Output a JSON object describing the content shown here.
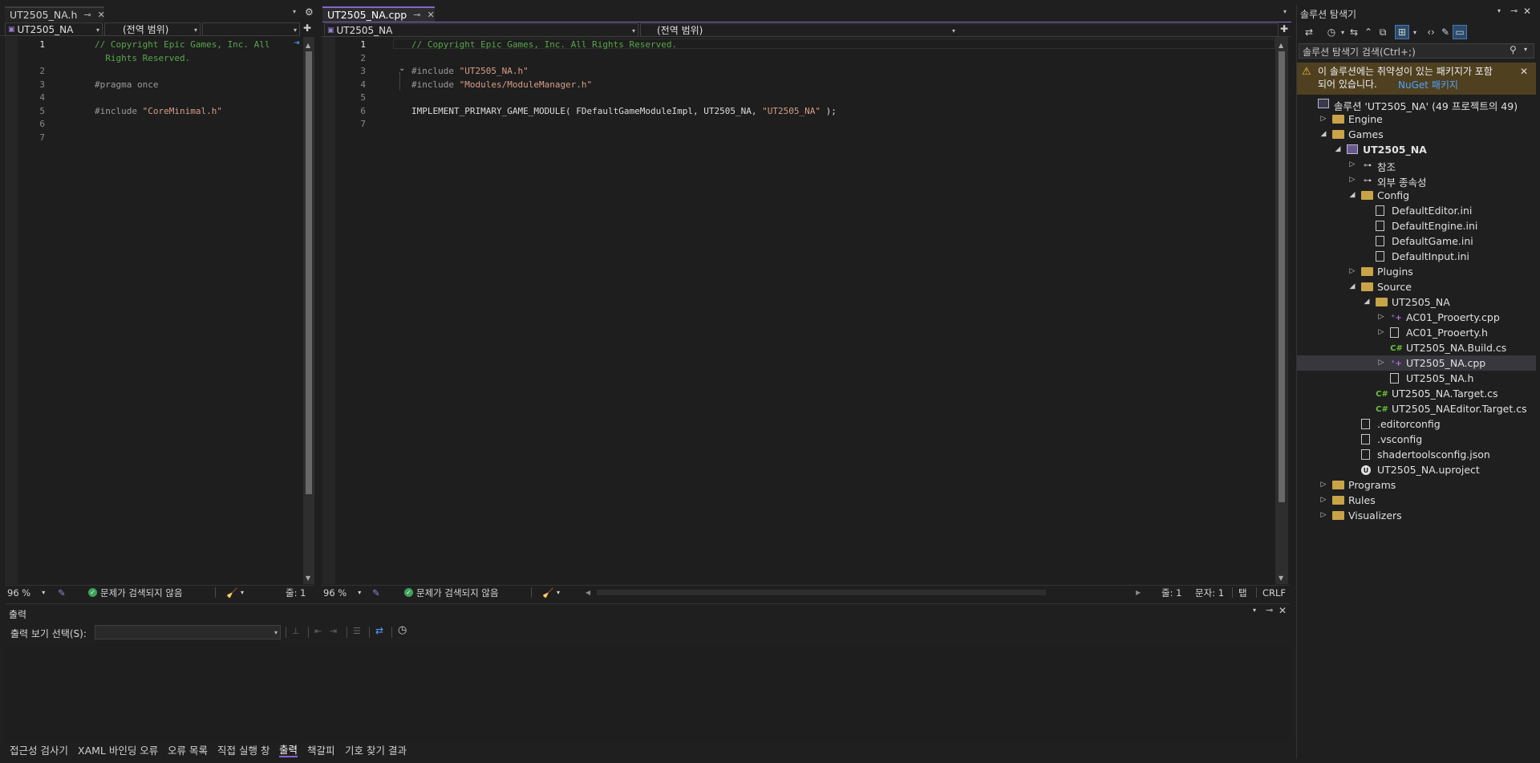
{
  "left_editor": {
    "tab_title": "UT2505_NA.h",
    "pin_icon": "pin-icon",
    "close_icon": "close-icon",
    "nav_project": "UT2505_NA",
    "nav_scope": "(전역 범위)",
    "lines": [
      {
        "no": "1",
        "current": true,
        "segments": [
          {
            "cls": "tok-comment",
            "text": "// Copyright Epic Games, Inc. All"
          }
        ]
      },
      {
        "no": "",
        "current": false,
        "segments": [
          {
            "cls": "tok-comment",
            "text": "  Rights Reserved."
          }
        ]
      },
      {
        "no": "2",
        "current": false,
        "segments": []
      },
      {
        "no": "3",
        "current": false,
        "segments": [
          {
            "cls": "tok-pre",
            "text": "#pragma once"
          }
        ]
      },
      {
        "no": "4",
        "current": false,
        "segments": []
      },
      {
        "no": "5",
        "current": false,
        "segments": [
          {
            "cls": "tok-pre",
            "text": "#include "
          },
          {
            "cls": "tok-str",
            "text": "\"CoreMinimal.h\""
          }
        ]
      },
      {
        "no": "6",
        "current": false,
        "segments": []
      },
      {
        "no": "7",
        "current": false,
        "segments": []
      }
    ],
    "status": {
      "zoom": "96 %",
      "issues": "문제가 검색되지 않음",
      "line": "줄: 1"
    }
  },
  "right_editor": {
    "tab_title": "UT2505_NA.cpp",
    "nav_project": "UT2505_NA",
    "nav_scope": "(전역 범위)",
    "nav_member": "",
    "lines": [
      {
        "no": "1",
        "current": true,
        "segments": [
          {
            "cls": "tok-comment",
            "text": "// Copyright Epic Games, Inc. All Rights Reserved."
          }
        ]
      },
      {
        "no": "2",
        "current": false,
        "segments": []
      },
      {
        "no": "3",
        "current": false,
        "fold": "⌄",
        "segments": [
          {
            "cls": "tok-pre",
            "text": "#include "
          },
          {
            "cls": "tok-str",
            "text": "\"UT2505_NA.h\""
          }
        ]
      },
      {
        "no": "4",
        "current": false,
        "segments": [
          {
            "cls": "tok-pre",
            "text": "#include "
          },
          {
            "cls": "tok-str",
            "text": "\"Modules/ModuleManager.h\""
          }
        ]
      },
      {
        "no": "5",
        "current": false,
        "segments": []
      },
      {
        "no": "6",
        "current": false,
        "segments": [
          {
            "cls": "tok-plain",
            "text": "IMPLEMENT_PRIMARY_GAME_MODULE( FDefaultGameModuleImpl, UT2505_NA, "
          },
          {
            "cls": "tok-str",
            "text": "\"UT2505_NA\""
          },
          {
            "cls": "tok-plain",
            "text": " );"
          }
        ]
      },
      {
        "no": "7",
        "current": false,
        "segments": []
      }
    ],
    "status": {
      "zoom": "96 %",
      "issues": "문제가 검색되지 않음",
      "line": "줄: 1",
      "col": "문자: 1",
      "indent": "탭",
      "eol": "CRLF"
    }
  },
  "output_panel": {
    "title": "출력",
    "source_label": "출력 보기 선택(S):",
    "source_value": ""
  },
  "bottom_tabs": [
    {
      "label": "접근성 검사기",
      "active": false
    },
    {
      "label": "XAML 바인딩 오류",
      "active": false
    },
    {
      "label": "오류 목록",
      "active": false
    },
    {
      "label": "직접 실행 창",
      "active": false
    },
    {
      "label": "출력",
      "active": true
    },
    {
      "label": "책갈피",
      "active": false
    },
    {
      "label": "기호 찾기 결과",
      "active": false
    }
  ],
  "solution_explorer": {
    "title": "솔루션 탐색기",
    "search_placeholder": "솔루션 탐색기 검색(Ctrl+;)",
    "warning_text": "이 솔루션에는 취약성이 있는 패키지가 포함되어 있습니다.",
    "warning_link": "NuGet 패키지",
    "tree": [
      {
        "label": "솔루션 'UT2505_NA' (49 프로젝트의 49)",
        "indent": 0,
        "expander": "",
        "icon": "sln",
        "bold": false,
        "selected": false
      },
      {
        "label": "Engine",
        "indent": 1,
        "expander": "▷",
        "icon": "folder",
        "bold": false,
        "selected": false
      },
      {
        "label": "Games",
        "indent": 1,
        "expander": "◢",
        "icon": "folder",
        "bold": false,
        "selected": false
      },
      {
        "label": "UT2505_NA",
        "indent": 2,
        "expander": "◢",
        "icon": "proj-ic",
        "bold": true,
        "selected": false
      },
      {
        "label": "참조",
        "indent": 3,
        "expander": "▷",
        "icon": "ref",
        "bold": false,
        "selected": false
      },
      {
        "label": "외부 종속성",
        "indent": 3,
        "expander": "▷",
        "icon": "ref",
        "bold": false,
        "selected": false
      },
      {
        "label": "Config",
        "indent": 3,
        "expander": "◢",
        "icon": "folder",
        "bold": false,
        "selected": false
      },
      {
        "label": "DefaultEditor.ini",
        "indent": 4,
        "expander": "",
        "icon": "file",
        "bold": false,
        "selected": false
      },
      {
        "label": "DefaultEngine.ini",
        "indent": 4,
        "expander": "",
        "icon": "file",
        "bold": false,
        "selected": false
      },
      {
        "label": "DefaultGame.ini",
        "indent": 4,
        "expander": "",
        "icon": "file",
        "bold": false,
        "selected": false
      },
      {
        "label": "DefaultInput.ini",
        "indent": 4,
        "expander": "",
        "icon": "file",
        "bold": false,
        "selected": false
      },
      {
        "label": "Plugins",
        "indent": 3,
        "expander": "▷",
        "icon": "folder",
        "bold": false,
        "selected": false
      },
      {
        "label": "Source",
        "indent": 3,
        "expander": "◢",
        "icon": "folder",
        "bold": false,
        "selected": false
      },
      {
        "label": "UT2505_NA",
        "indent": 4,
        "expander": "◢",
        "icon": "folder",
        "bold": false,
        "selected": false
      },
      {
        "label": "AC01_Prooerty.cpp",
        "indent": 5,
        "expander": "▷",
        "icon": "cpp",
        "bold": false,
        "selected": false
      },
      {
        "label": "AC01_Prooerty.h",
        "indent": 5,
        "expander": "▷",
        "icon": "file",
        "bold": false,
        "selected": false
      },
      {
        "label": "UT2505_NA.Build.cs",
        "indent": 5,
        "expander": "",
        "icon": "cs",
        "bold": false,
        "selected": false
      },
      {
        "label": "UT2505_NA.cpp",
        "indent": 5,
        "expander": "▷",
        "icon": "cpp",
        "bold": false,
        "selected": true
      },
      {
        "label": "UT2505_NA.h",
        "indent": 5,
        "expander": "",
        "icon": "file",
        "bold": false,
        "selected": false
      },
      {
        "label": "UT2505_NA.Target.cs",
        "indent": 4,
        "expander": "",
        "icon": "cs",
        "bold": false,
        "selected": false
      },
      {
        "label": "UT2505_NAEditor.Target.cs",
        "indent": 4,
        "expander": "",
        "icon": "cs",
        "bold": false,
        "selected": false
      },
      {
        "label": ".editorconfig",
        "indent": 3,
        "expander": "",
        "icon": "file",
        "bold": false,
        "selected": false
      },
      {
        "label": ".vsconfig",
        "indent": 3,
        "expander": "",
        "icon": "file",
        "bold": false,
        "selected": false
      },
      {
        "label": "shadertoolsconfig.json",
        "indent": 3,
        "expander": "",
        "icon": "file",
        "bold": false,
        "selected": false
      },
      {
        "label": "UT2505_NA.uproject",
        "indent": 3,
        "expander": "",
        "icon": "ue",
        "bold": false,
        "selected": false
      },
      {
        "label": "Programs",
        "indent": 1,
        "expander": "▷",
        "icon": "folder",
        "bold": false,
        "selected": false
      },
      {
        "label": "Rules",
        "indent": 1,
        "expander": "▷",
        "icon": "folder",
        "bold": false,
        "selected": false
      },
      {
        "label": "Visualizers",
        "indent": 1,
        "expander": "▷",
        "icon": "folder",
        "bold": false,
        "selected": false
      }
    ]
  },
  "colors": {
    "accent": "#8866cc",
    "background": "#1f1f1f",
    "editor_bg": "#1e1e1e",
    "warning_bg": "#4f4020",
    "comment": "#57a64a",
    "string": "#d69d85",
    "link": "#4fa3ff"
  }
}
